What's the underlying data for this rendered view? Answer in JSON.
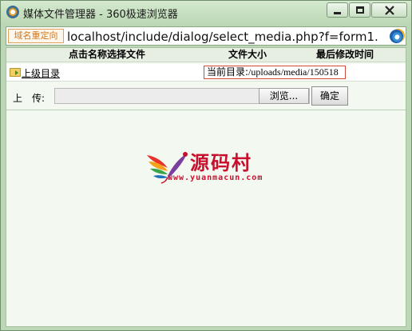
{
  "window": {
    "title": "媒体文件管理器 - 360极速浏览器"
  },
  "address_bar": {
    "redirect_tag": "域名重定向",
    "url": "localhost/include/dialog/select_media.php?f=form1.",
    "icon": "ie-icon"
  },
  "file_list": {
    "columns": [
      "点击名称选择文件",
      "文件大小",
      "最后修改时间"
    ],
    "parent_dir_label": "上级目录",
    "current_dir_label": "当前目录:",
    "current_dir_path": "/uploads/media/150518"
  },
  "upload": {
    "label": "上　传:",
    "file_value": "",
    "browse_label": "浏览...",
    "confirm_label": "确定"
  },
  "watermark": {
    "brand": "源码村",
    "url": "www.yuanmacun.com",
    "color": "#c8102e"
  },
  "colors": {
    "frame": "#bcd7b6",
    "content_bg": "#f3f9f1",
    "current_dir_border": "#d04a3c"
  }
}
